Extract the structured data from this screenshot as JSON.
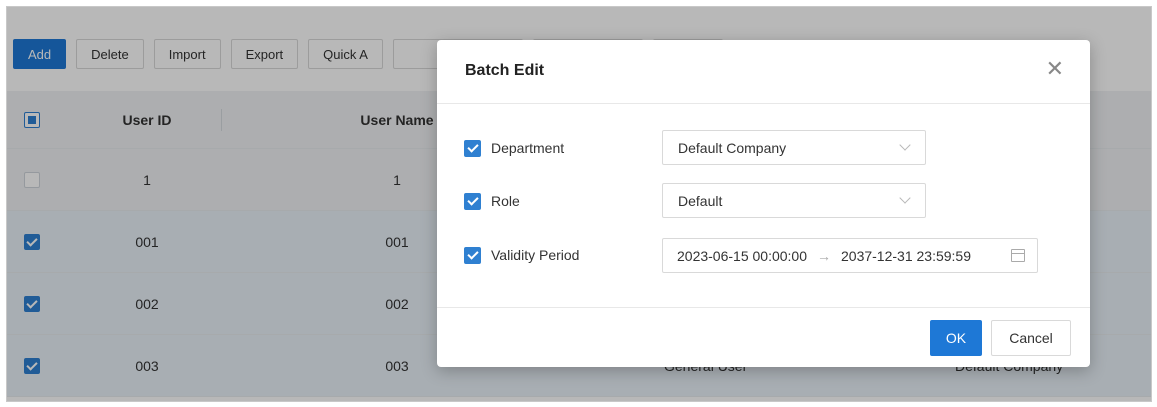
{
  "toolbar": {
    "add": "Add",
    "delete": "Delete",
    "import": "Import",
    "export": "Export",
    "quick_add": "Quick A"
  },
  "table": {
    "headers": {
      "user_id": "User ID",
      "user_name": "User Name"
    },
    "rows": [
      {
        "id": "1",
        "name": "1",
        "role": "",
        "department": "",
        "checked": false
      },
      {
        "id": "001",
        "name": "001",
        "role": "",
        "department": "",
        "checked": true
      },
      {
        "id": "002",
        "name": "002",
        "role": "",
        "department": "",
        "checked": true
      },
      {
        "id": "003",
        "name": "003",
        "role": "General User",
        "department": "Default Company",
        "checked": true
      }
    ]
  },
  "modal": {
    "title": "Batch Edit",
    "close_icon": "close-icon",
    "fields": {
      "department": {
        "label": "Department",
        "value": "Default Company",
        "checked": true
      },
      "role": {
        "label": "Role",
        "value": "Default",
        "checked": true
      },
      "validity": {
        "label": "Validity Period",
        "start": "2023-06-15 00:00:00",
        "end": "2037-12-31 23:59:59",
        "separator": "→",
        "checked": true
      }
    },
    "ok": "OK",
    "cancel": "Cancel"
  },
  "colors": {
    "primary": "#1e78d6",
    "checkbox": "#2f80d1",
    "selected_row": "#e9f1f8"
  }
}
